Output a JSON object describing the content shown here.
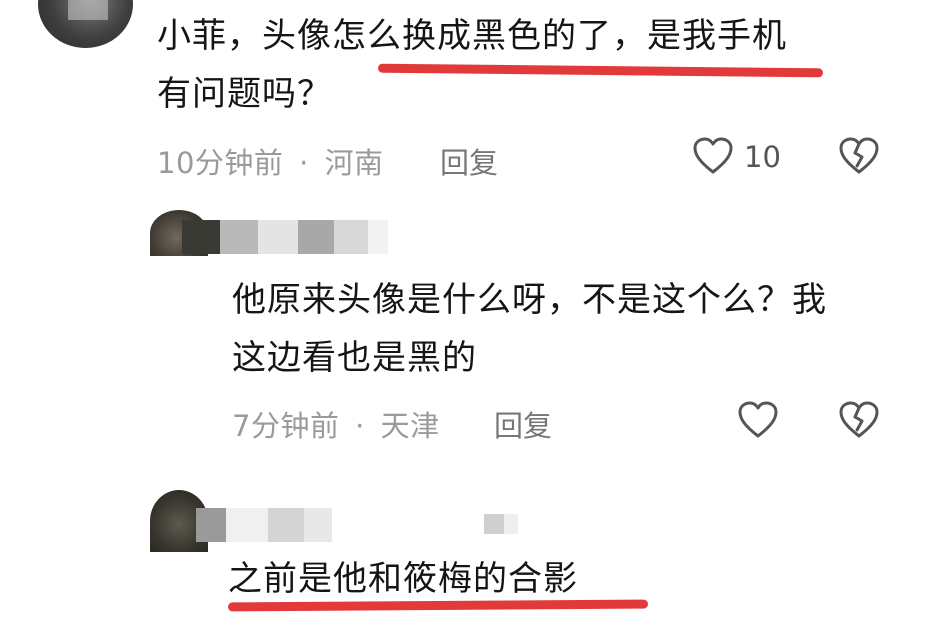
{
  "comments": [
    {
      "text_line1": "小菲，头像怎么换成黑色的了，是我手机",
      "text_line2": "有问题吗？",
      "time": "10分钟前",
      "location": "河南",
      "reply_label": "回复",
      "like_count": "10"
    },
    {
      "text_line1": "他原来头像是什么呀，不是这个么？我",
      "text_line2": "这边看也是黑的",
      "time": "7分钟前",
      "location": "天津",
      "reply_label": "回复"
    },
    {
      "text_line1": "之前是他和筱梅的合影"
    }
  ],
  "separator": "·",
  "icons": {
    "like": "heart-outline-icon",
    "dislike": "broken-heart-icon"
  },
  "colors": {
    "highlight_underline": "#e23a3a",
    "meta_text": "#9a9a9a"
  }
}
